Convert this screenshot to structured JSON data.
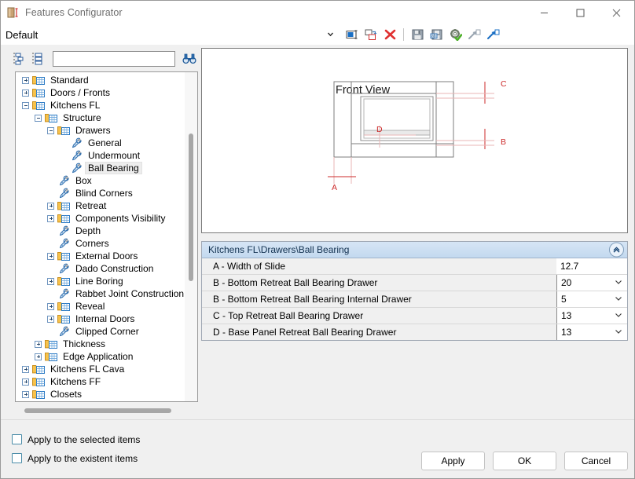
{
  "window": {
    "title": "Features Configurator",
    "app_icon": "cabinet-dimension-icon",
    "minimize": "minimize-icon",
    "maximize": "maximize-icon",
    "close": "close-icon"
  },
  "preset": {
    "value": "Default",
    "caret": "chevron-down-icon"
  },
  "toolbar": {
    "buttons": [
      {
        "name": "rename-icon",
        "title": "Rename"
      },
      {
        "name": "duplicate-icon",
        "title": "Duplicate"
      },
      {
        "name": "delete-icon",
        "title": "Delete"
      },
      {
        "name": "save-icon",
        "title": "Save"
      },
      {
        "name": "save-as-icon",
        "title": "Save As"
      },
      {
        "name": "settings-apply-icon",
        "title": "Apply Settings"
      },
      {
        "name": "export-icon",
        "title": "Export"
      },
      {
        "name": "import-icon",
        "title": "Import"
      }
    ]
  },
  "tree_toolbar": {
    "collapse_all": "collapse-all-icon",
    "expand_all": "expand-all-icon",
    "search_value": "",
    "search_placeholder": "",
    "find": "binoculars-icon"
  },
  "tree": {
    "nodes": [
      {
        "label": "Standard",
        "depth": 0,
        "twisty": "plus",
        "icon": "folder",
        "selected": false
      },
      {
        "label": "Doors / Fronts",
        "depth": 0,
        "twisty": "plus",
        "icon": "folder",
        "selected": false
      },
      {
        "label": "Kitchens FL",
        "depth": 0,
        "twisty": "minus",
        "icon": "folder",
        "selected": false
      },
      {
        "label": "Structure",
        "depth": 1,
        "twisty": "minus",
        "icon": "folder",
        "selected": false
      },
      {
        "label": "Drawers",
        "depth": 2,
        "twisty": "minus",
        "icon": "folder",
        "selected": false
      },
      {
        "label": "General",
        "depth": 3,
        "twisty": "none",
        "icon": "leaf",
        "selected": false
      },
      {
        "label": "Undermount",
        "depth": 3,
        "twisty": "none",
        "icon": "leaf",
        "selected": false
      },
      {
        "label": "Ball Bearing",
        "depth": 3,
        "twisty": "none",
        "icon": "leaf",
        "selected": true
      },
      {
        "label": "Box",
        "depth": 2,
        "twisty": "none",
        "icon": "leaf",
        "selected": false
      },
      {
        "label": "Blind Corners",
        "depth": 2,
        "twisty": "none",
        "icon": "leaf",
        "selected": false
      },
      {
        "label": "Retreat",
        "depth": 2,
        "twisty": "plus",
        "icon": "folder",
        "selected": false
      },
      {
        "label": "Components Visibility",
        "depth": 2,
        "twisty": "plus",
        "icon": "folder",
        "selected": false
      },
      {
        "label": "Depth",
        "depth": 2,
        "twisty": "none",
        "icon": "leaf",
        "selected": false
      },
      {
        "label": "Corners",
        "depth": 2,
        "twisty": "none",
        "icon": "leaf",
        "selected": false
      },
      {
        "label": "External Doors",
        "depth": 2,
        "twisty": "plus",
        "icon": "folder",
        "selected": false
      },
      {
        "label": "Dado Construction",
        "depth": 2,
        "twisty": "none",
        "icon": "leaf",
        "selected": false
      },
      {
        "label": "Line Boring",
        "depth": 2,
        "twisty": "plus",
        "icon": "folder",
        "selected": false
      },
      {
        "label": "Rabbet Joint Construction",
        "depth": 2,
        "twisty": "none",
        "icon": "leaf",
        "selected": false
      },
      {
        "label": "Reveal",
        "depth": 2,
        "twisty": "plus",
        "icon": "folder",
        "selected": false
      },
      {
        "label": "Internal Doors",
        "depth": 2,
        "twisty": "plus",
        "icon": "folder",
        "selected": false
      },
      {
        "label": "Clipped Corner",
        "depth": 2,
        "twisty": "none",
        "icon": "leaf",
        "selected": false
      },
      {
        "label": "Thickness",
        "depth": 1,
        "twisty": "plus",
        "icon": "folder",
        "selected": false
      },
      {
        "label": "Edge Application",
        "depth": 1,
        "twisty": "plus",
        "icon": "folder",
        "selected": false
      },
      {
        "label": "Kitchens FL Cava",
        "depth": 0,
        "twisty": "plus",
        "icon": "folder",
        "selected": false
      },
      {
        "label": "Kitchens FF",
        "depth": 0,
        "twisty": "plus",
        "icon": "folder",
        "selected": false
      },
      {
        "label": "Closets",
        "depth": 0,
        "twisty": "plus",
        "icon": "folder",
        "selected": false
      },
      {
        "label": "",
        "depth": 0,
        "twisty": "none",
        "icon": "folder",
        "selected": false
      }
    ]
  },
  "preview": {
    "title": "Front View",
    "labels": {
      "a": "A",
      "b": "B",
      "c": "C",
      "d": "D"
    }
  },
  "properties": {
    "header": "Kitchens FL\\Drawers\\Ball Bearing",
    "collapse_icon": "chevron-up-icon",
    "rows": [
      {
        "label": "A - Width of Slide",
        "value": "12.7",
        "type": "text"
      },
      {
        "label": "B - Bottom Retreat Ball Bearing Drawer",
        "value": "20",
        "type": "combo"
      },
      {
        "label": "B - Bottom Retreat Ball Bearing Internal Drawer",
        "value": "5",
        "type": "combo"
      },
      {
        "label": "C - Top Retreat Ball Bearing Drawer",
        "value": "13",
        "type": "combo"
      },
      {
        "label": "D - Base Panel Retreat Ball Bearing Drawer",
        "value": "13",
        "type": "combo"
      }
    ]
  },
  "bottom": {
    "checkboxes": [
      {
        "label": "Apply to the selected items",
        "checked": false
      },
      {
        "label": "Apply to the existent items",
        "checked": false
      }
    ],
    "buttons": [
      {
        "label": "Apply"
      },
      {
        "label": "OK"
      },
      {
        "label": "Cancel"
      }
    ]
  },
  "colors": {
    "accent_blue": "#2b5b9a",
    "folder_orange": "#f5b841",
    "dimension_red": "#cc2b2b",
    "header_blue": "#c3d9ef",
    "delete_red": "#e03131",
    "check_green": "#4caf27"
  }
}
